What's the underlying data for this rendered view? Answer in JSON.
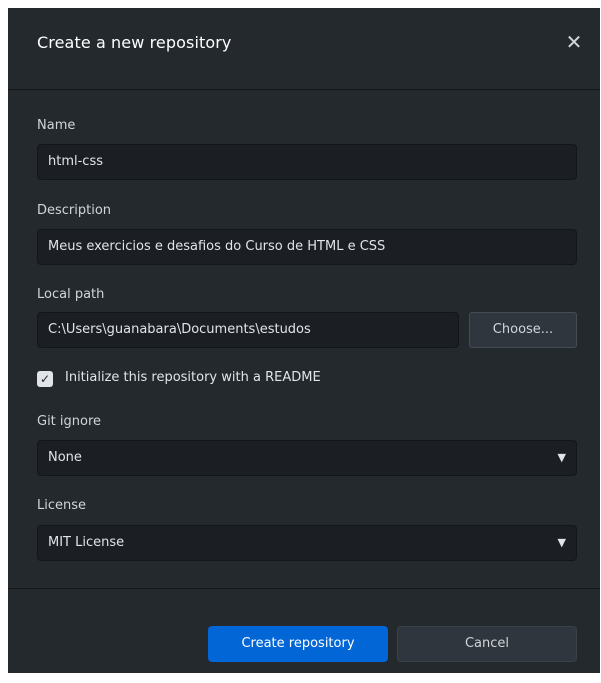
{
  "dialog": {
    "title": "Create a new repository",
    "close_icon": "close-icon"
  },
  "form": {
    "name": {
      "label": "Name",
      "value": "html-css"
    },
    "description": {
      "label": "Description",
      "value": "Meus exercicios e desafios do Curso de HTML e CSS"
    },
    "local_path": {
      "label": "Local path",
      "value": "C:\\Users\\guanabara\\Documents\\estudos",
      "choose_label": "Choose..."
    },
    "readme": {
      "label": "Initialize this repository with a README",
      "checked": true
    },
    "gitignore": {
      "label": "Git ignore",
      "value": "None"
    },
    "license": {
      "label": "License",
      "value": "MIT License"
    }
  },
  "footer": {
    "create_label": "Create repository",
    "cancel_label": "Cancel"
  },
  "colors": {
    "background": "#24292e",
    "field": "#1b1f23",
    "primary": "#0366d6"
  }
}
